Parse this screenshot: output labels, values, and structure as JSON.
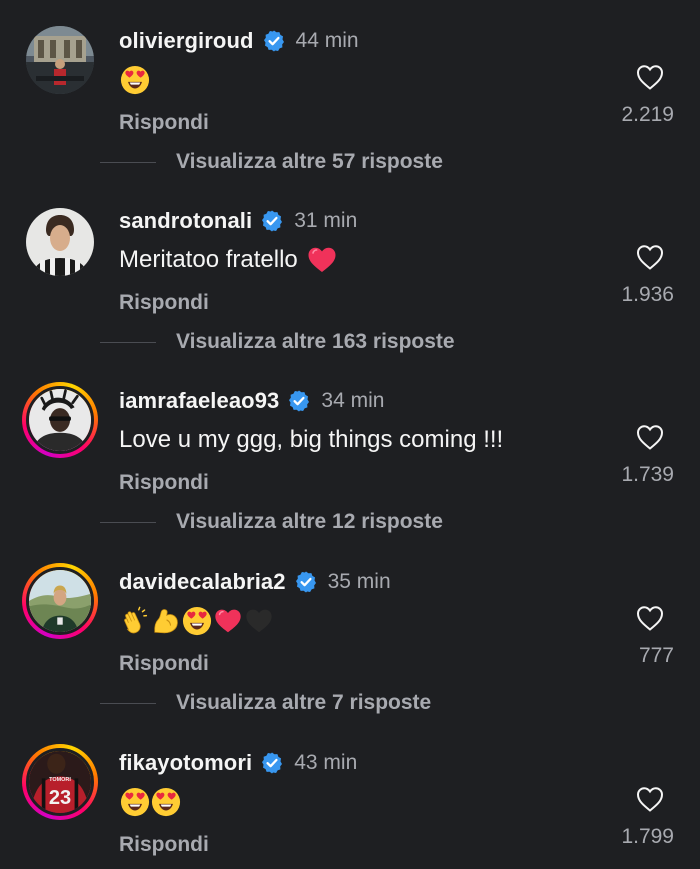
{
  "comments": [
    {
      "username": "oliviergiroud",
      "time": "44 min",
      "text": "",
      "reply": "Rispondi",
      "likes": "2.219",
      "more_replies": "Visualizza altre 57 risposte"
    },
    {
      "username": "sandrotonali",
      "time": "31 min",
      "text": "Meritatoo fratello",
      "reply": "Rispondi",
      "likes": "1.936",
      "more_replies": "Visualizza altre 163 risposte"
    },
    {
      "username": "iamrafaeleao93",
      "time": "34 min",
      "text": "Love u my ggg, big things coming !!!",
      "reply": "Rispondi",
      "likes": "1.739",
      "more_replies": "Visualizza altre 12 risposte"
    },
    {
      "username": "davidecalabria2",
      "time": "35 min",
      "text": "",
      "reply": "Rispondi",
      "likes": "777",
      "more_replies": "Visualizza altre 7 risposte"
    },
    {
      "username": "fikayotomori",
      "time": "43 min",
      "text": "",
      "reply": "Rispondi",
      "likes": "1.799",
      "jersey_number": "23",
      "jersey_name": "TOMORI"
    }
  ],
  "colors": {
    "background": "#1e1f22",
    "verified": "#3897f0",
    "muted_text": "#a8aab0"
  }
}
